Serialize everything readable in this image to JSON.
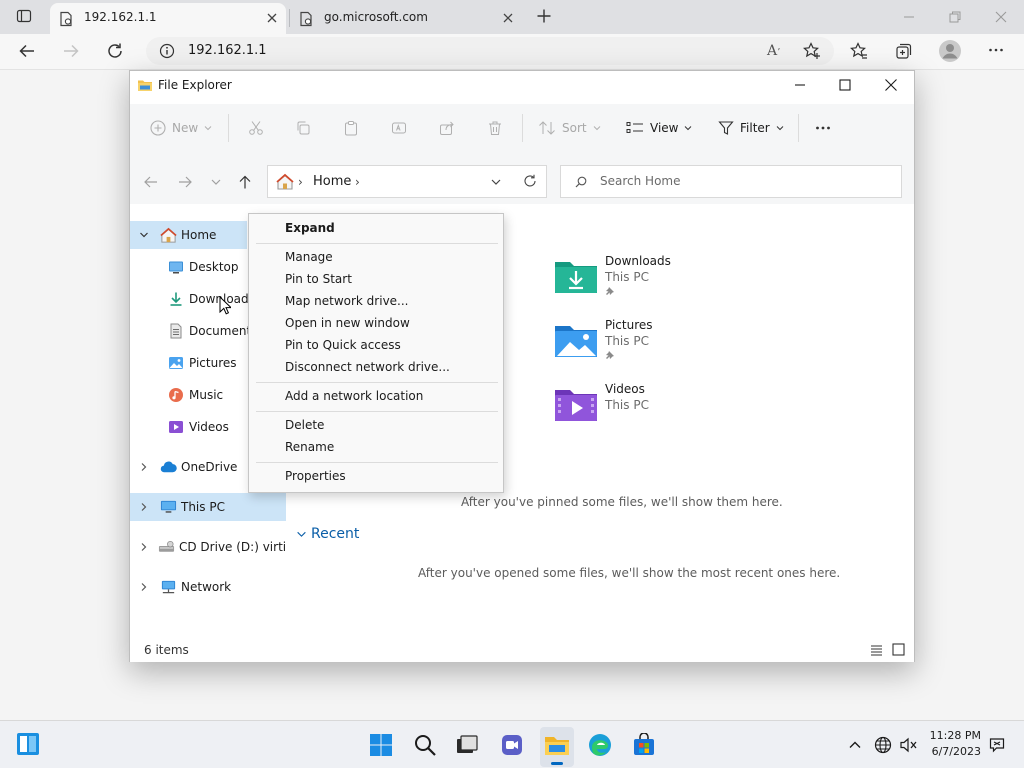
{
  "browser": {
    "tabs": [
      {
        "title": "192.162.1.1",
        "active": true
      },
      {
        "title": "go.microsoft.com",
        "active": false
      }
    ],
    "url": "192.162.1.1"
  },
  "explorer": {
    "title": "File Explorer",
    "toolbar": {
      "new_label": "New",
      "sort_label": "Sort",
      "view_label": "View",
      "filter_label": "Filter"
    },
    "breadcrumb": "Home",
    "search_placeholder": "Search Home",
    "nav": {
      "home": "Home",
      "desktop": "Desktop",
      "downloads": "Downloads",
      "documents": "Documents",
      "pictures": "Pictures",
      "music": "Music",
      "videos": "Videos",
      "onedrive": "OneDrive",
      "this_pc": "This PC",
      "cd_drive": "CD Drive (D:) virtio-win",
      "network": "Network"
    },
    "folders": [
      {
        "name": "Downloads",
        "location": "This PC",
        "pinned": true
      },
      {
        "name": "Pictures",
        "location": "This PC",
        "pinned": true
      },
      {
        "name": "Videos",
        "location": "This PC",
        "pinned": false
      }
    ],
    "pinned_empty": "After you've pinned some files, we'll show them here.",
    "recent_header": "Recent",
    "recent_empty": "After you've opened some files, we'll show the most recent ones here.",
    "status": "6 items"
  },
  "context_menu": {
    "expand": "Expand",
    "manage": "Manage",
    "pin_start": "Pin to Start",
    "map_drive": "Map network drive...",
    "open_new_window": "Open in new window",
    "pin_quick": "Pin to Quick access",
    "disconnect_drive": "Disconnect network drive...",
    "add_location": "Add a network location",
    "delete": "Delete",
    "rename": "Rename",
    "properties": "Properties"
  },
  "taskbar": {
    "time": "11:28 PM",
    "date": "6/7/2023"
  },
  "colors": {
    "selection": "#cce4f7",
    "accent": "#0067c0",
    "folder_downloads": "#1fa58e",
    "folder_pictures": "#2b8de3",
    "folder_videos": "#8a4fd3"
  }
}
